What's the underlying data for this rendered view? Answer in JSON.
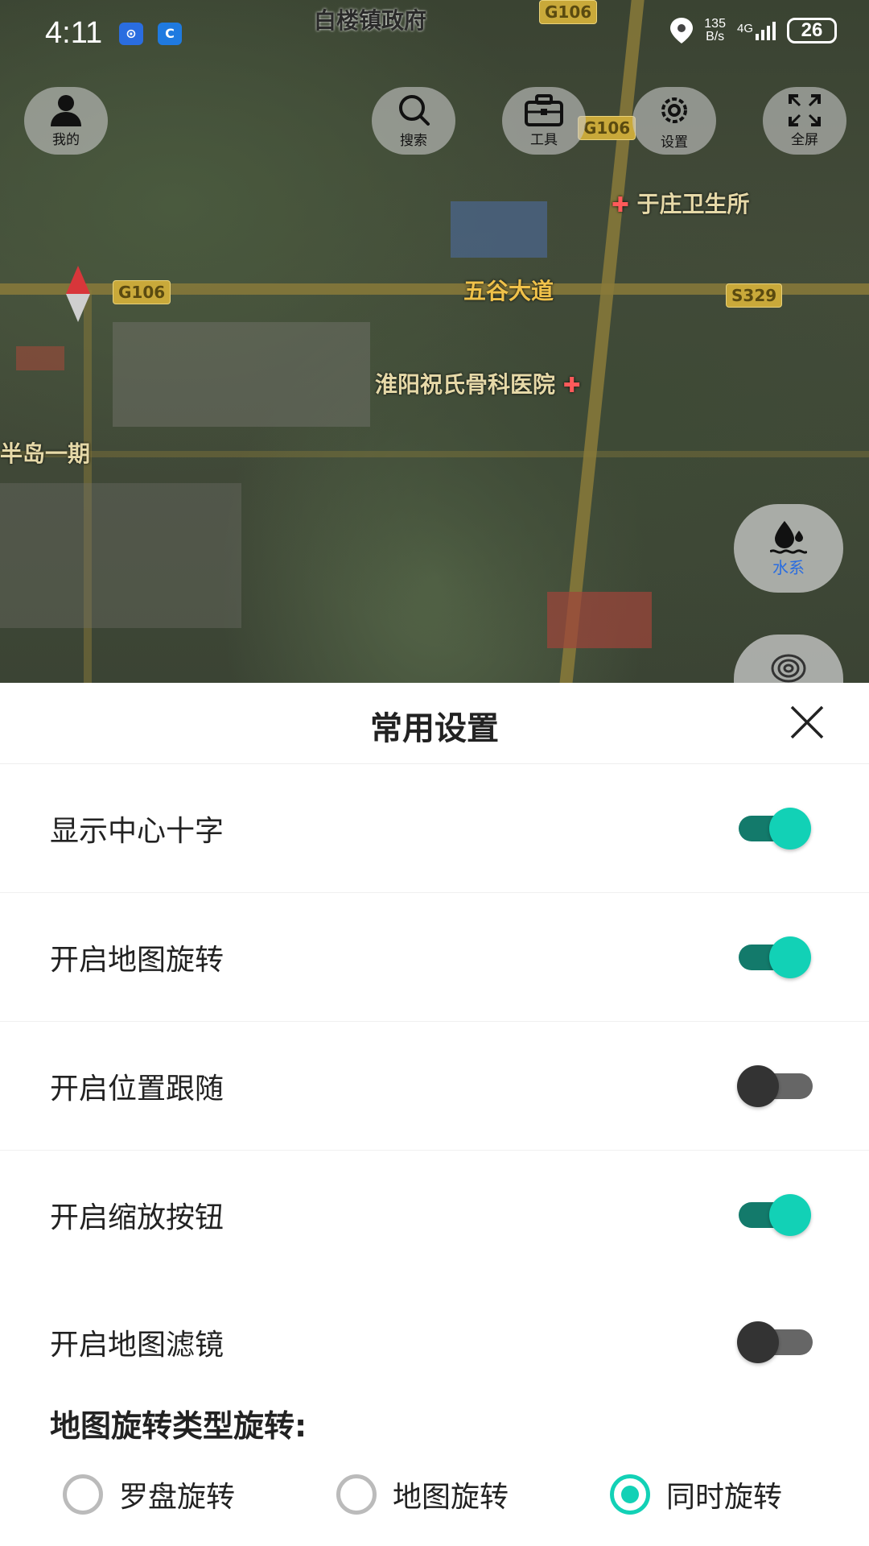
{
  "status_bar": {
    "time": "4:11",
    "speed_value": "135",
    "speed_unit": "B/s",
    "network": "4G",
    "battery": "26"
  },
  "map": {
    "labels": {
      "town_gov": "白楼镇政府",
      "clinic": "于庄卫生所",
      "avenue": "五谷大道",
      "hospital": "淮阳祝氏骨科医院",
      "community": "半岛一期"
    },
    "road_tags": [
      "G106",
      "G106",
      "G106",
      "S329"
    ]
  },
  "top_buttons": {
    "mine": "我的",
    "search": "搜索",
    "tools": "工具",
    "settings": "设置",
    "fullscreen": "全屏"
  },
  "side_buttons": {
    "water": "水系"
  },
  "sheet": {
    "title": "常用设置",
    "settings": [
      {
        "label": "显示中心十字",
        "on": true
      },
      {
        "label": "开启地图旋转",
        "on": true
      },
      {
        "label": "开启位置跟随",
        "on": false
      },
      {
        "label": "开启缩放按钮",
        "on": true
      },
      {
        "label": "开启地图滤镜",
        "on": false
      }
    ],
    "rotation_title": "地图旋转类型旋转:",
    "rotation_options": [
      {
        "label": "罗盘旋转",
        "selected": false
      },
      {
        "label": "地图旋转",
        "selected": false
      },
      {
        "label": "同时旋转",
        "selected": true
      }
    ]
  },
  "colors": {
    "accent": "#12d1b6",
    "accent_dark": "#137a6b"
  }
}
